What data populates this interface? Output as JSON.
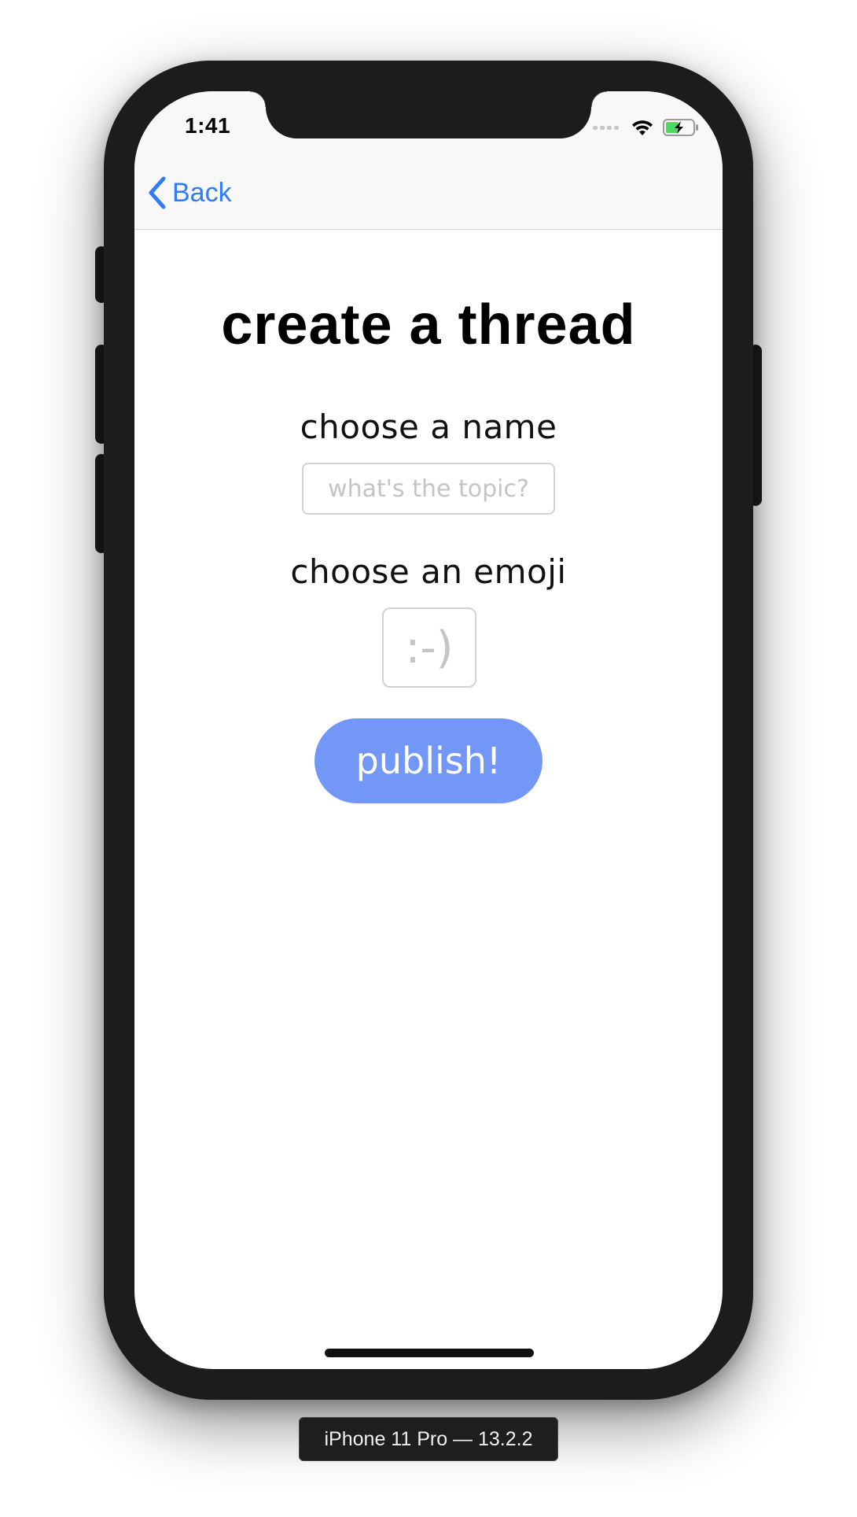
{
  "status_bar": {
    "time": "1:41",
    "icons": [
      "cellular-signal-icon",
      "wifi-icon",
      "battery-charging-icon"
    ],
    "battery_color": "#4cd964"
  },
  "nav": {
    "back_label": "Back",
    "back_icon": "chevron-left-icon",
    "accent_color": "#2f7cf6"
  },
  "form": {
    "title": "create a thread",
    "name_label": "choose a name",
    "name_value": "",
    "name_placeholder": "what's the topic?",
    "emoji_label": "choose an emoji",
    "emoji_value": "",
    "emoji_placeholder": ":-)",
    "publish_label": "publish!",
    "publish_color": "#7397f7"
  },
  "device": {
    "label": "iPhone 11 Pro — 13.2.2"
  }
}
